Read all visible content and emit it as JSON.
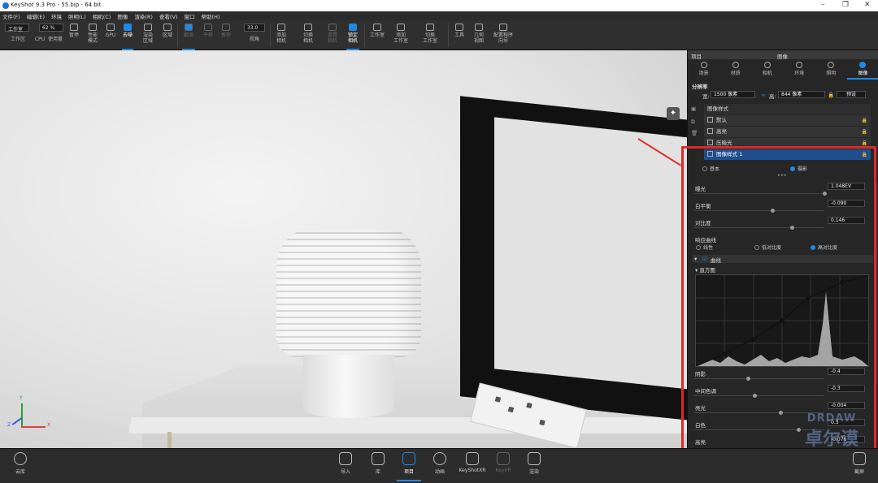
{
  "window": {
    "title": "KeyShot 9.3 Pro  - 55.bip  - 64 bit",
    "controls": [
      "–",
      "❐",
      "✕"
    ]
  },
  "menu": [
    "文件(F)",
    "编辑(E)",
    "环境",
    "照明(L)",
    "相机(C)",
    "图像",
    "渲染(R)",
    "查看(V)",
    "窗口",
    "帮助(H)"
  ],
  "toolbar": {
    "workspace_select": "工作室",
    "workspace_label": "工作区",
    "cpu_label": "CPU",
    "usage_value": "62 %",
    "usage_label": "使用量",
    "pause_label": "暂停",
    "perf_label": "性能\n模式",
    "gpu_label": "GPU",
    "denoise_label": "去噪",
    "render_region_label": "渲染\n区域",
    "region_label": "区域",
    "rotate_label": "翻滚",
    "pan_label": "平移",
    "dolly_label": "推移",
    "fov_value": "33.0",
    "fov_label": "视角",
    "add_camera_label": "添加\n相机",
    "switch_camera_label": "切换\n相机",
    "reset_camera_label": "重置\n相机",
    "lock_camera_label": "锁定\n相机",
    "studio_label": "工作室",
    "add_studio_label": "添加\n工作室",
    "switch_studio_label": "切换\n工作室",
    "tools_label": "工具",
    "geometry_label": "几何\n视图",
    "config_label": "配置程序\n向导"
  },
  "viewport": {
    "axis_labels": {
      "y": "Y",
      "x": "X",
      "z": "Z"
    }
  },
  "panel": {
    "header_left": "项目",
    "header_title": "图像",
    "tabs": [
      {
        "label": "场景",
        "icon": "scene-icon"
      },
      {
        "label": "材质",
        "icon": "material-icon"
      },
      {
        "label": "相机",
        "icon": "camera-icon"
      },
      {
        "label": "环境",
        "icon": "environment-icon"
      },
      {
        "label": "照明",
        "icon": "lighting-icon"
      },
      {
        "label": "图像",
        "icon": "image-icon"
      }
    ],
    "resolution_title": "分辨率",
    "width_label": "宽:",
    "width_value": "1500 像素",
    "height_label": "高:",
    "height_value": "844 像素",
    "preset_label": "预设",
    "styles_title": "图像样式",
    "styles": [
      {
        "name": "默认",
        "selected": false
      },
      {
        "name": "高亮",
        "selected": false
      },
      {
        "name": "压暗光",
        "selected": false
      },
      {
        "name": "图像样式 1",
        "selected": true
      }
    ],
    "mode_basic": "基本",
    "mode_photo": "摄影",
    "exposure_label": "曝光",
    "exposure_value": "1.048EV",
    "whitebalance_label": "白平衡",
    "whitebalance_value": "-0.090",
    "contrast_label": "对比度",
    "contrast_value": "0.146",
    "response_label": "响应曲线",
    "response_linear": "线性",
    "response_low": "低对比度",
    "response_high": "高对比度",
    "curve_section": "曲线",
    "histogram_label": "直方图",
    "shadows_label": "阴影",
    "shadows_value": "-0.4",
    "midtones_label": "中间色调",
    "midtones_value": "-0.3",
    "highlights_label": "亮光",
    "highlights_value": "-0.004",
    "whites_label": "白色",
    "whites_value": "0.3",
    "highs_label": "高亮",
    "highs_value": "-0.076"
  },
  "bottombar": {
    "cloud_label": "云库",
    "items": [
      {
        "label": "导入",
        "icon": "import-icon",
        "active": false,
        "dim": false
      },
      {
        "label": "库",
        "icon": "library-icon",
        "active": false,
        "dim": false
      },
      {
        "label": "项目",
        "icon": "project-icon",
        "active": true,
        "dim": false
      },
      {
        "label": "动画",
        "icon": "animation-icon",
        "active": false,
        "dim": false
      },
      {
        "label": "KeyShotXR",
        "icon": "keyshotxr-icon",
        "active": false,
        "dim": false
      },
      {
        "label": "KeyVR",
        "icon": "keyvr-icon",
        "active": false,
        "dim": true
      },
      {
        "label": "渲染",
        "icon": "render-icon",
        "active": false,
        "dim": false
      }
    ],
    "screenshot_label": "截屏"
  },
  "watermark": {
    "line1": "DRDAW",
    "line2": "卓尔谟"
  },
  "colors": {
    "accent": "#1e8ae6",
    "highlight_box": "#e02828",
    "selected_row": "#1e4f8c"
  }
}
